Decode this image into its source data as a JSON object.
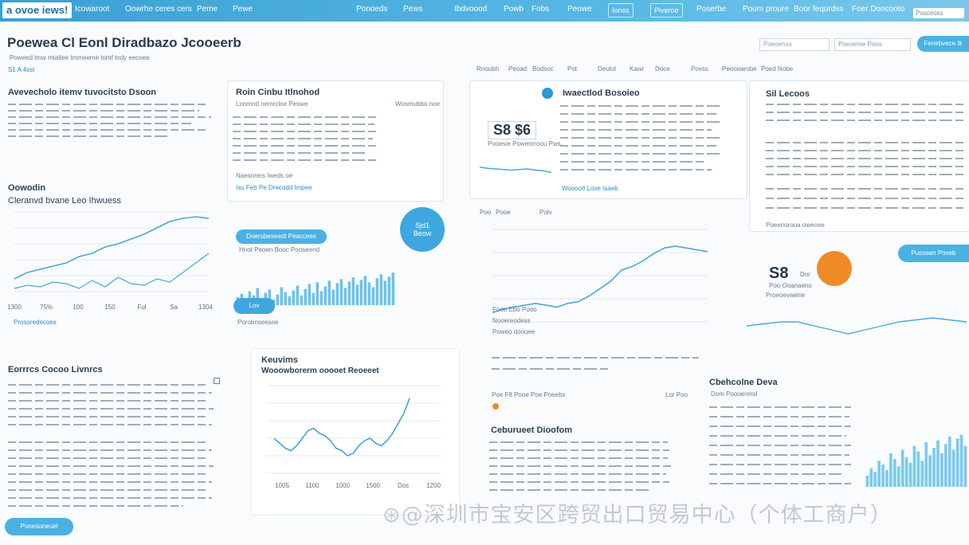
{
  "topbar": {
    "brand": "a ovoe iews!",
    "nav": [
      "Icowaroot",
      "Oowrhe ceres cers",
      "Peme",
      "Pewe",
      "Ponoeds",
      "Pews",
      "Ibdvoood",
      "Powb",
      "Fobs",
      "Peowe",
      "Ionss",
      "Piveroe",
      "Poserbe",
      "Poum proure",
      "Boor fequrdss",
      "Foer Doncooto"
    ],
    "search_placeholder": "Posceoss"
  },
  "page": {
    "title": "Poewea Cl Eonl Diradbazo Jcooeerb",
    "subtitle": "Poweed tmw mtaltee tmmeeme tomf tndy eecoee",
    "small": "S1 A 4sst",
    "filter_a": "Poeoenss",
    "filter_b": "Poeoeme Poos",
    "primary_button": "Fenebvece Ik"
  },
  "tabs": [
    "Rnoubh",
    "Peoad",
    "Bodsoc",
    "Pot",
    "Deulot",
    "Kawr",
    "Doce",
    "Povss",
    "Peoooarobe",
    "Poed Nobe"
  ],
  "sections": {
    "overview": {
      "title": "Avevecholo itemv tuvocitsto Dsoon",
      "chart_title": "Oowodin",
      "chart_subtitle": "Cleranvd bvane Leo Ihwuess",
      "footnote": "Prosoredecoes"
    },
    "card_report": {
      "title": "Roin Cinbu Itlnohod",
      "subtitle": "Lonmnd nemrcloe Peswe",
      "corner": "Wosmubbo noe",
      "link_a": "Naesnrers Iweds oe",
      "link_b": "Isu Feb Pe Drecodd Impee",
      "pill": "Doerubeseedt Peaccees",
      "pill_b": "Lov",
      "caption": "Hnot Peoen Booc Pooseend",
      "footer": "Porobnseesoe"
    },
    "circle_blue": "Sjd1\nBeow",
    "kpi_card": {
      "title": "Iwaectlod Bosoieo",
      "kpi": "S8 $6",
      "kpi_caption": "Pooesie Poweorroou Pws",
      "chart_caption": "Wooootl Lose Isaeb",
      "axis_a": "Poo",
      "axis_b": "Pooe",
      "axis_c": "Polv"
    },
    "side_card": {
      "title": "Sil Lecoos",
      "caption": "Poeenorooa oweoee"
    },
    "side_button": "Puossen Poveb",
    "kpi_orange": {
      "value": "S8",
      "unit": "Dor",
      "caption": "Poo Ooanaeno",
      "caption_b": "Proeoevaelne"
    },
    "trend": {
      "label_a": "Fooe Ebo Pooo",
      "label_b": "Nooereodess",
      "label_c": "Poweo doouee",
      "row_a": "Poe F8 Pooe Poe Poeebs",
      "row_b": "Lor Poo"
    },
    "events": {
      "title": "Eorrrcs Cocoo Livnrcs"
    },
    "kevinfo": {
      "title": "Keuvims",
      "subtitle": "Wooowborerm ooooet Reoeeet"
    },
    "channel": {
      "title": "Cbehcolne Deva",
      "subtitle": "Dom Poooerend"
    },
    "stat_card": {
      "title": "Ceburueet Dioofom"
    },
    "footer_button": "Ponesoneuel",
    "watermark": "⊛@深圳市宝安区跨贸出口贸易中心（个体工商户）"
  },
  "colors": {
    "accent": "#4ab2e3",
    "line": "#4aa8d8",
    "orange": "#f08a24",
    "nav": "#3a9fd3"
  },
  "chart_data": [
    {
      "type": "line",
      "x": [
        1,
        2,
        3,
        4,
        5,
        6,
        7,
        8,
        9,
        10,
        11,
        12,
        13,
        14,
        15,
        16
      ],
      "series": [
        {
          "values": [
            8,
            12,
            14,
            16,
            18,
            22,
            24,
            28,
            30,
            33,
            36,
            40,
            44,
            46,
            47,
            46
          ]
        },
        {
          "values": [
            2,
            4,
            3,
            6,
            5,
            2,
            7,
            3,
            9,
            5,
            4,
            8,
            6,
            12,
            18,
            24
          ]
        }
      ],
      "ylim": [
        0,
        50
      ],
      "grid": true,
      "x_ticks": [
        "1300",
        "75%",
        "100",
        "150",
        "Ful",
        "Sa",
        "1304"
      ]
    },
    {
      "type": "bar",
      "values": [
        10,
        14,
        8,
        17,
        12,
        21,
        9,
        15,
        19,
        7,
        13,
        22,
        16,
        11,
        18,
        24,
        12,
        20,
        26,
        15,
        28,
        17,
        23,
        30,
        19,
        27,
        32,
        21,
        29,
        34,
        25,
        31,
        36,
        28,
        22,
        33,
        38,
        30,
        35,
        40
      ],
      "ylim": [
        0,
        45
      ]
    },
    {
      "type": "line",
      "values": [
        5,
        7,
        8,
        9,
        10,
        9,
        8,
        10,
        11,
        14,
        18,
        22,
        28,
        30,
        33,
        37,
        40,
        41,
        40,
        39,
        38
      ],
      "ylim": [
        0,
        50
      ]
    },
    {
      "type": "line",
      "values": [
        14,
        12,
        10,
        9,
        11,
        14,
        17,
        18,
        16,
        15,
        13,
        10,
        9,
        7,
        8,
        11,
        13,
        14,
        12,
        11,
        13,
        16,
        20,
        24,
        30
      ],
      "ylim": [
        0,
        35
      ],
      "x_ticks": [
        "1005",
        "1100",
        "1000",
        "1500",
        "Dos",
        "1200"
      ]
    },
    {
      "type": "line",
      "values": [
        10,
        11,
        12,
        12,
        10,
        8,
        6,
        8,
        10,
        12,
        13,
        14,
        13,
        12
      ],
      "ylim": [
        0,
        20
      ]
    },
    {
      "type": "bar",
      "values": [
        6,
        10,
        8,
        14,
        12,
        9,
        18,
        15,
        11,
        20,
        16,
        13,
        22,
        19,
        14,
        24,
        17,
        21,
        25,
        18,
        23,
        27,
        20,
        26,
        28,
        22
      ],
      "ylim": [
        0,
        30
      ]
    },
    {
      "type": "line",
      "values": [
        3,
        4,
        6,
        5,
        8,
        6,
        9,
        7,
        10,
        8,
        11,
        12,
        10,
        13,
        15,
        18,
        16,
        20,
        24,
        27
      ],
      "ylim": [
        0,
        30
      ]
    }
  ]
}
